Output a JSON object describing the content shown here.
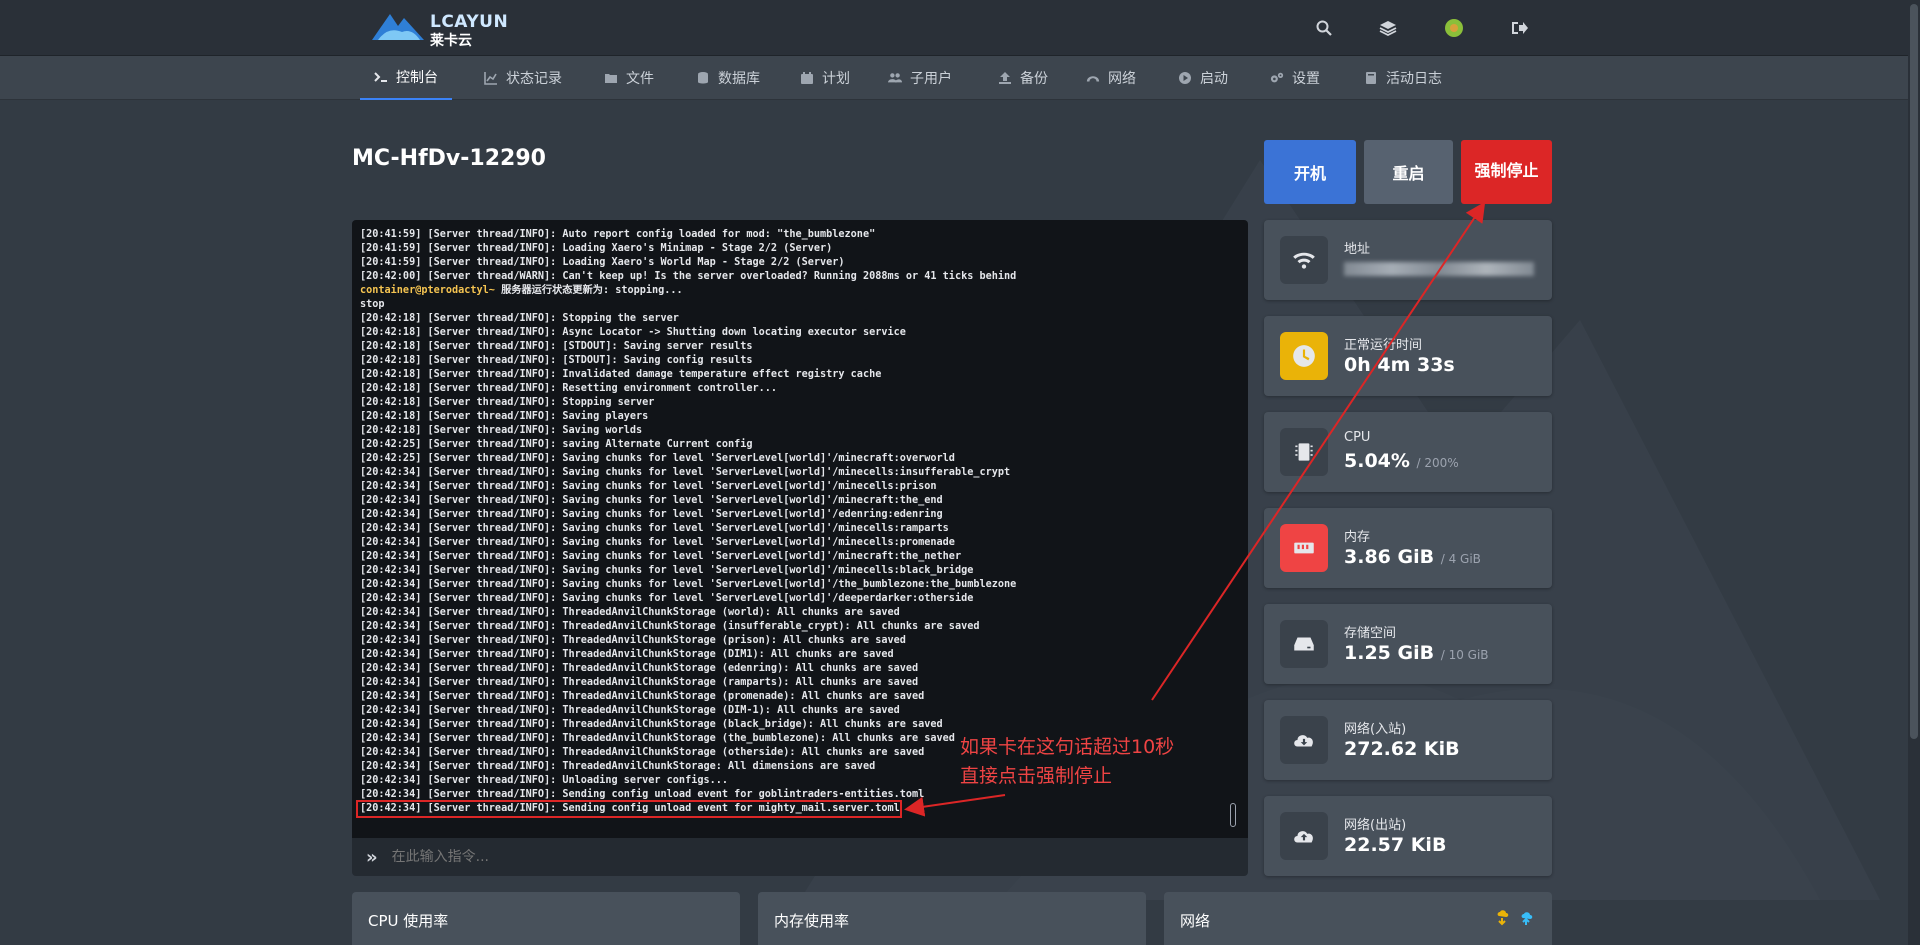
{
  "brand": {
    "name": "LCAYUN",
    "sub": "莱卡云"
  },
  "nav": {
    "items": [
      {
        "label": "控制台",
        "icon": "terminal-icon",
        "active": true
      },
      {
        "label": "状态记录",
        "icon": "chart-line-icon"
      },
      {
        "label": "文件",
        "icon": "folder-icon"
      },
      {
        "label": "数据库",
        "icon": "database-icon"
      },
      {
        "label": "计划",
        "icon": "calendar-icon"
      },
      {
        "label": "子用户",
        "icon": "users-icon"
      },
      {
        "label": "备份",
        "icon": "upload-icon"
      },
      {
        "label": "网络",
        "icon": "network-icon"
      },
      {
        "label": "启动",
        "icon": "play-circle-icon"
      },
      {
        "label": "设置",
        "icon": "cogs-icon"
      },
      {
        "label": "活动日志",
        "icon": "book-icon"
      }
    ]
  },
  "server": {
    "name": "MC-HfDv-12290"
  },
  "power": {
    "start": "开机",
    "restart": "重启",
    "kill": "强制停止"
  },
  "console": {
    "lines": [
      "[20:41:59] [Server thread/INFO]: Auto report config loaded for mod: \"the_bumblezone\"",
      "[20:41:59] [Server thread/INFO]: Loading Xaero's Minimap - Stage 2/2 (Server)",
      "[20:41:59] [Server thread/INFO]: Loading Xaero's World Map - Stage 2/2 (Server)",
      "[20:42:00] [Server thread/WARN]: Can't keep up! Is the server overloaded? Running 2088ms or 41 ticks behind",
      "container@pterodactyl~ 服务器运行状态更新为: stopping...",
      "stop",
      "[20:42:18] [Server thread/INFO]: Stopping the server",
      "[20:42:18] [Server thread/INFO]: Async Locator -> Shutting down locating executor service",
      "[20:42:18] [Server thread/INFO]: [STDOUT]: Saving server results",
      "[20:42:18] [Server thread/INFO]: [STDOUT]: Saving config results",
      "[20:42:18] [Server thread/INFO]: Invalidated damage temperature effect registry cache",
      "[20:42:18] [Server thread/INFO]: Resetting environment controller...",
      "[20:42:18] [Server thread/INFO]: Stopping server",
      "[20:42:18] [Server thread/INFO]: Saving players",
      "[20:42:18] [Server thread/INFO]: Saving worlds",
      "[20:42:25] [Server thread/INFO]: saving Alternate Current config",
      "[20:42:25] [Server thread/INFO]: Saving chunks for level 'ServerLevel[world]'/minecraft:overworld",
      "[20:42:34] [Server thread/INFO]: Saving chunks for level 'ServerLevel[world]'/minecells:insufferable_crypt",
      "[20:42:34] [Server thread/INFO]: Saving chunks for level 'ServerLevel[world]'/minecells:prison",
      "[20:42:34] [Server thread/INFO]: Saving chunks for level 'ServerLevel[world]'/minecraft:the_end",
      "[20:42:34] [Server thread/INFO]: Saving chunks for level 'ServerLevel[world]'/edenring:edenring",
      "[20:42:34] [Server thread/INFO]: Saving chunks for level 'ServerLevel[world]'/minecells:ramparts",
      "[20:42:34] [Server thread/INFO]: Saving chunks for level 'ServerLevel[world]'/minecells:promenade",
      "[20:42:34] [Server thread/INFO]: Saving chunks for level 'ServerLevel[world]'/minecraft:the_nether",
      "[20:42:34] [Server thread/INFO]: Saving chunks for level 'ServerLevel[world]'/minecells:black_bridge",
      "[20:42:34] [Server thread/INFO]: Saving chunks for level 'ServerLevel[world]'/the_bumblezone:the_bumblezone",
      "[20:42:34] [Server thread/INFO]: Saving chunks for level 'ServerLevel[world]'/deeperdarker:otherside",
      "[20:42:34] [Server thread/INFO]: ThreadedAnvilChunkStorage (world): All chunks are saved",
      "[20:42:34] [Server thread/INFO]: ThreadedAnvilChunkStorage (insufferable_crypt): All chunks are saved",
      "[20:42:34] [Server thread/INFO]: ThreadedAnvilChunkStorage (prison): All chunks are saved",
      "[20:42:34] [Server thread/INFO]: ThreadedAnvilChunkStorage (DIM1): All chunks are saved",
      "[20:42:34] [Server thread/INFO]: ThreadedAnvilChunkStorage (edenring): All chunks are saved",
      "[20:42:34] [Server thread/INFO]: ThreadedAnvilChunkStorage (ramparts): All chunks are saved",
      "[20:42:34] [Server thread/INFO]: ThreadedAnvilChunkStorage (promenade): All chunks are saved",
      "[20:42:34] [Server thread/INFO]: ThreadedAnvilChunkStorage (DIM-1): All chunks are saved",
      "[20:42:34] [Server thread/INFO]: ThreadedAnvilChunkStorage (black_bridge): All chunks are saved",
      "[20:42:34] [Server thread/INFO]: ThreadedAnvilChunkStorage (the_bumblezone): All chunks are saved",
      "[20:42:34] [Server thread/INFO]: ThreadedAnvilChunkStorage (otherside): All chunks are saved",
      "[20:42:34] [Server thread/INFO]: ThreadedAnvilChunkStorage: All dimensions are saved",
      "[20:42:34] [Server thread/INFO]: Unloading server configs...",
      "[20:42:34] [Server thread/INFO]: Sending config unload event for goblintraders-entities.toml",
      "[20:42:34] [Server thread/INFO]: Sending config unload event for mighty_mail.server.toml"
    ],
    "input_placeholder": "在此输入指令..."
  },
  "stats": [
    {
      "label": "地址",
      "value": "",
      "icon": "wifi-icon",
      "icon_bg": "#3a424b"
    },
    {
      "label": "正常运行时间",
      "value": "0h 4m 33s",
      "icon": "clock-icon",
      "icon_bg": "#eab308"
    },
    {
      "label": "CPU",
      "value": "5.04%",
      "sub": "/ 200%",
      "icon": "microchip-icon",
      "icon_bg": "#3a424b"
    },
    {
      "label": "内存",
      "value": "3.86 GiB",
      "sub": "/ 4 GiB",
      "icon": "memory-icon",
      "icon_bg": "#ef4444"
    },
    {
      "label": "存储空间",
      "value": "1.25 GiB",
      "sub": "/ 10 GiB",
      "icon": "hdd-icon",
      "icon_bg": "#3a424b"
    },
    {
      "label": "网络(入站)",
      "value": "272.62 KiB",
      "icon": "cloud-download-icon",
      "icon_bg": "#3a424b"
    },
    {
      "label": "网络(出站)",
      "value": "22.57 KiB",
      "icon": "cloud-upload-icon",
      "icon_bg": "#3a424b"
    }
  ],
  "bottom_cards": [
    "CPU 使用率",
    "内存使用率",
    "网络"
  ],
  "annotation": {
    "line1": "如果卡在这句话超过10秒",
    "line2": "直接点击强制停止"
  },
  "colors": {
    "accent": "#3b73d6",
    "danger": "#dc2626",
    "warn": "#eab308"
  }
}
